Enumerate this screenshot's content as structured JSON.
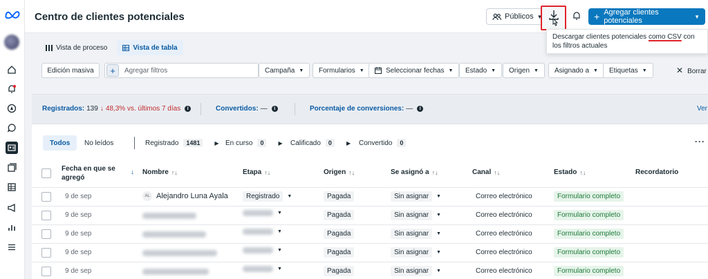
{
  "header": {
    "title": "Centro de clientes potenciales",
    "publicos_label": "Públicos",
    "add_label": "Agregar clientes potenciales"
  },
  "tooltip": {
    "pre": "Descargar clientes potenciales ",
    "highlight": "como CSV",
    "post": " con los filtros actuales"
  },
  "views": [
    "Vista de proceso",
    "Vista de tabla"
  ],
  "filters": {
    "bulk_edit": "Edición masiva",
    "add_placeholder": "Agregar filtros",
    "items": [
      "Campaña",
      "Formularios",
      "Seleccionar fechas",
      "Estado",
      "Origen",
      "Asignado a",
      "Etiquetas"
    ],
    "clear": "Borrar filtros"
  },
  "stats": {
    "registered_label": "Registrados:",
    "registered_value": "139",
    "registered_change": "48,3% vs. últimos 7 días",
    "converted_label": "Convertidos:",
    "converted_value": "—",
    "conversion_label": "Porcentaje de conversiones:",
    "conversion_value": "—",
    "more": "Ver"
  },
  "stage_tabs": {
    "all": "Todos",
    "unread": "No leídos",
    "stages": [
      {
        "label": "Registrado",
        "count": "1481"
      },
      {
        "label": "En curso",
        "count": "0"
      },
      {
        "label": "Calificado",
        "count": "0"
      },
      {
        "label": "Convertido",
        "count": "0"
      }
    ]
  },
  "columns": {
    "date": "Fecha en que se agregó",
    "name": "Nombre",
    "stage": "Etapa",
    "origin": "Origen",
    "assigned": "Se asignó a",
    "channel": "Canal",
    "status": "Estado",
    "reminder": "Recordatorio"
  },
  "rows": [
    {
      "date": "9 de sep",
      "initials": "AL",
      "name": "Alejandro Luna Ayala",
      "stage": "Registrado",
      "origin": "Pagada",
      "assigned": "Sin asignar",
      "channel": "Correo electrónico",
      "status": "Formulario completo"
    },
    {
      "date": "9 de sep",
      "initials": "",
      "name": "",
      "stage": "",
      "origin": "Pagada",
      "assigned": "Sin asignar",
      "channel": "Correo electrónico",
      "status": "Formulario completo"
    },
    {
      "date": "9 de sep",
      "initials": "",
      "name": "",
      "stage": "",
      "origin": "Pagada",
      "assigned": "Sin asignar",
      "channel": "Correo electrónico",
      "status": "Formulario completo"
    },
    {
      "date": "9 de sep",
      "initials": "",
      "name": "",
      "stage": "",
      "origin": "Pagada",
      "assigned": "Sin asignar",
      "channel": "Correo electrónico",
      "status": "Formulario completo"
    },
    {
      "date": "9 de sep",
      "initials": "",
      "name": "",
      "stage": "",
      "origin": "Pagada",
      "assigned": "Sin asignar",
      "channel": "Correo electrónico",
      "status": "Formulario completo"
    }
  ],
  "colors": {
    "primary": "#0a78be",
    "link": "#0a5aa3",
    "highlight_red": "#e0242a",
    "status_green": "#1e7b3a"
  }
}
